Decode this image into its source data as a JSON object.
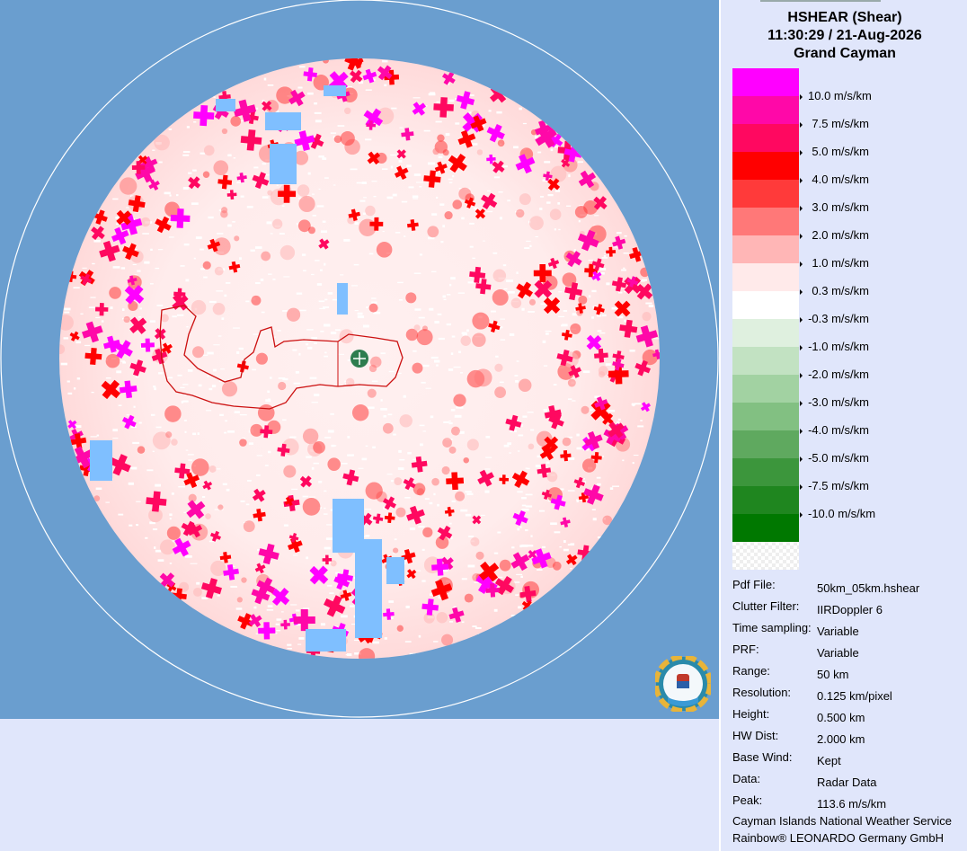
{
  "header": {
    "product": "HSHEAR (Shear)",
    "datetime": "11:30:29 / 21-Aug-2026",
    "site": "Grand Cayman"
  },
  "legend": [
    {
      "label": "10.0 m/s/km",
      "color": "#ff00ff"
    },
    {
      "label": "7.5 m/s/km",
      "color": "#ff08a8"
    },
    {
      "label": "5.0 m/s/km",
      "color": "#ff0860"
    },
    {
      "label": "4.0 m/s/km",
      "color": "#ff0000"
    },
    {
      "label": "3.0 m/s/km",
      "color": "#ff3a3a"
    },
    {
      "label": "2.0 m/s/km",
      "color": "#ff7878"
    },
    {
      "label": "1.0 m/s/km",
      "color": "#ffb6b6"
    },
    {
      "label": "0.3 m/s/km",
      "color": "#ffeaea"
    },
    {
      "label": "-0.3 m/s/km",
      "color": "#ffffff"
    },
    {
      "label": "-1.0 m/s/km",
      "color": "#dff0df"
    },
    {
      "label": "-2.0 m/s/km",
      "color": "#c2e2c2"
    },
    {
      "label": "-3.0 m/s/km",
      "color": "#a2d2a2"
    },
    {
      "label": "-4.0 m/s/km",
      "color": "#82c082"
    },
    {
      "label": "-5.0 m/s/km",
      "color": "#5fa95f"
    },
    {
      "label": "-7.5 m/s/km",
      "color": "#3c963c"
    },
    {
      "label": "-10.0 m/s/km",
      "color": "#1f861f"
    },
    {
      "label": "",
      "color": "#007800"
    }
  ],
  "info": [
    {
      "key": "Pdf File:",
      "value": "50km_05km.hshear"
    },
    {
      "key": "Clutter Filter:",
      "value": "IIRDoppler 6"
    },
    {
      "key": "Time sampling:",
      "value": "Variable"
    },
    {
      "key": "PRF:",
      "value": "Variable"
    },
    {
      "key": "Range:",
      "value": "50 km"
    },
    {
      "key": "Resolution:",
      "value": "0.125 km/pixel"
    },
    {
      "key": "Height:",
      "value": "0.500 km"
    },
    {
      "key": "HW Dist:",
      "value": "2.000 km"
    },
    {
      "key": "Base Wind:",
      "value": "Kept"
    },
    {
      "key": "Data:",
      "value": "Radar Data"
    },
    {
      "key": "Peak:",
      "value": "113.6 m/s/km"
    }
  ],
  "credits": {
    "line1": "Cayman Islands National Weather Service",
    "line2": "Rainbow® LEONARDO Germany GmbH"
  },
  "colors": {
    "background": "#6a9ecf",
    "panel": "#e0e6fb",
    "no_data_blue": "#7fbfff",
    "radar_site": "#2e7d4f",
    "coastline": "#cc1010"
  },
  "icons": {
    "radar_site": "radar-site-marker-icon",
    "logo": "cayman-weather-service-logo"
  }
}
